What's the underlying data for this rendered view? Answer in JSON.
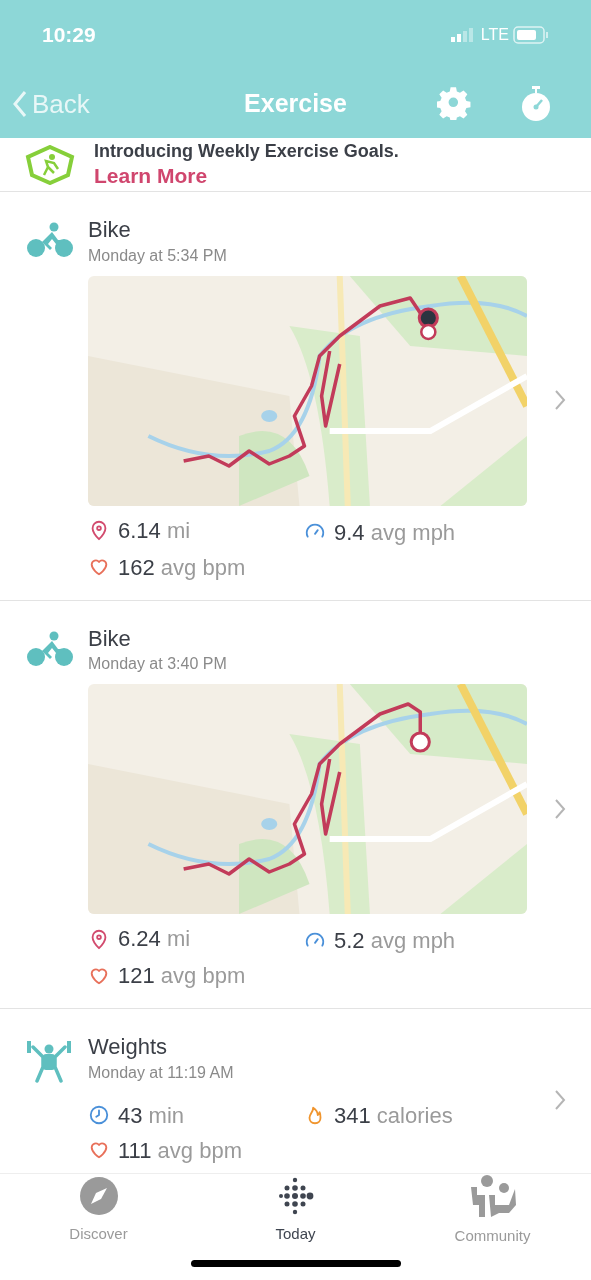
{
  "status_bar": {
    "time": "10:29",
    "network": "LTE"
  },
  "nav": {
    "back": "Back",
    "title": "Exercise"
  },
  "banner": {
    "title": "Introducing Weekly Exercise Goals.",
    "link": "Learn More"
  },
  "workouts": [
    {
      "kind": "bike",
      "name": "Bike",
      "time": "Monday at 5:34 PM",
      "metrics": [
        {
          "kind": "distance",
          "value": "6.14",
          "unit": "mi"
        },
        {
          "kind": "speed",
          "value": "9.4",
          "unit": "avg mph"
        },
        {
          "kind": "heart",
          "value": "162",
          "unit": "avg bpm"
        }
      ]
    },
    {
      "kind": "bike",
      "name": "Bike",
      "time": "Monday at 3:40 PM",
      "metrics": [
        {
          "kind": "distance",
          "value": "6.24",
          "unit": "mi"
        },
        {
          "kind": "speed",
          "value": "5.2",
          "unit": "avg mph"
        },
        {
          "kind": "heart",
          "value": "121",
          "unit": "avg bpm"
        }
      ]
    },
    {
      "kind": "weights",
      "name": "Weights",
      "time": "Monday at 11:19 AM",
      "metrics": [
        {
          "kind": "time",
          "value": "43",
          "unit": "min"
        },
        {
          "kind": "calories",
          "value": "341",
          "unit": "calories"
        },
        {
          "kind": "heart",
          "value": "111",
          "unit": "avg bpm"
        }
      ]
    }
  ],
  "tabs": [
    {
      "kind": "discover",
      "label": "Discover",
      "selected": false
    },
    {
      "kind": "today",
      "label": "Today",
      "selected": true
    },
    {
      "kind": "community",
      "label": "Community",
      "selected": false
    }
  ]
}
